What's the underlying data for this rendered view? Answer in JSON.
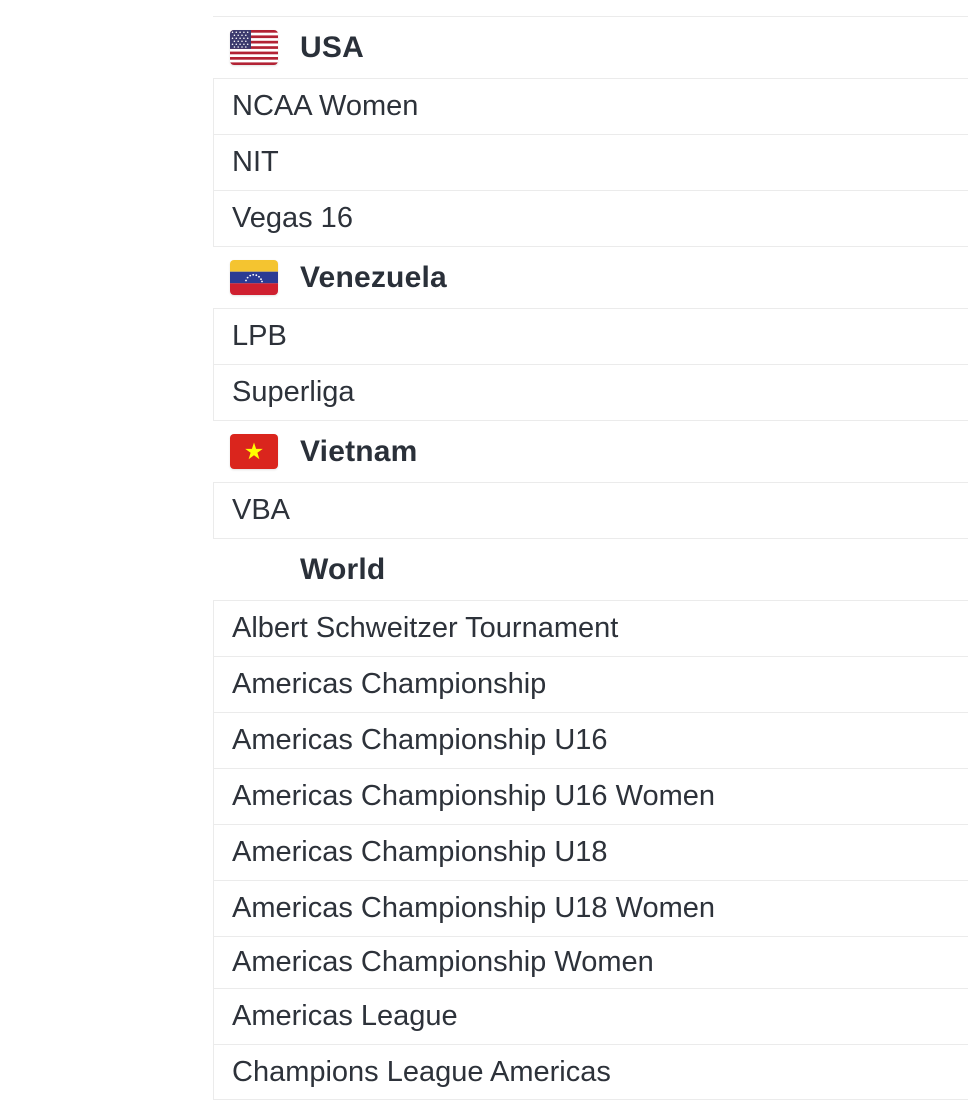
{
  "groups": [
    {
      "country": "USA",
      "flag": "us-flag-icon",
      "items": [
        "NCAA Women",
        "NIT",
        "Vegas 16"
      ]
    },
    {
      "country": "Venezuela",
      "flag": "venezuela-flag-icon",
      "items": [
        "LPB",
        "Superliga"
      ]
    },
    {
      "country": "Vietnam",
      "flag": "vietnam-flag-icon",
      "items": [
        "VBA"
      ]
    },
    {
      "country": "World",
      "flag": "",
      "items": [
        "Albert Schweitzer Tournament",
        "Americas Championship",
        "Americas Championship U16",
        "Americas Championship U16 Women",
        "Americas Championship U18",
        "Americas Championship U18 Women",
        "Americas Championship Women",
        "Americas League",
        "Champions League Americas"
      ]
    }
  ],
  "colors": {
    "text": "#2d323a",
    "divider": "#ebebeb",
    "us_red": "#b22234",
    "us_blue": "#3c3b6e",
    "ve_yellow": "#f4c430",
    "ve_blue": "#2b3b94",
    "ve_red": "#cf2030",
    "vn_red": "#da251d",
    "vn_star": "#ffff00"
  }
}
